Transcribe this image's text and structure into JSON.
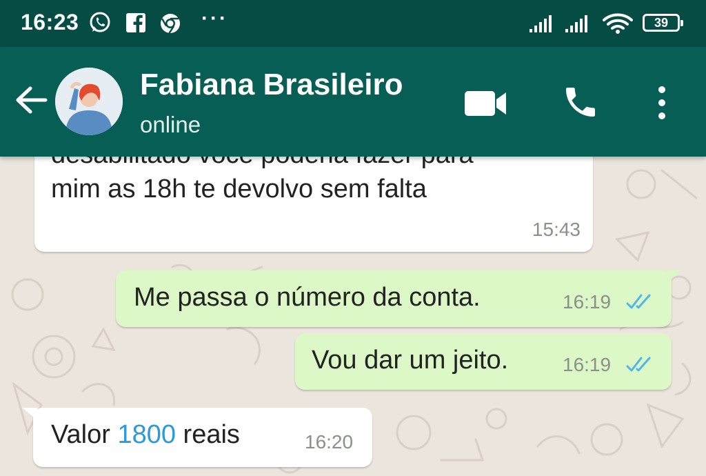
{
  "status_bar": {
    "time": "16:23",
    "battery": "39",
    "more_indicator": "···"
  },
  "header": {
    "contact_name": "Fabiana Brasileiro",
    "contact_status": "online"
  },
  "messages": [
    {
      "direction": "incoming",
      "line1": "desabilitado você poderia fazer para",
      "line2": "mim as 18h te devolvo sem falta",
      "time": "15:43"
    },
    {
      "direction": "outgoing",
      "text": "Me passa o número da conta.",
      "time": "16:19",
      "status": "read"
    },
    {
      "direction": "outgoing",
      "text": "Vou dar um jeito.",
      "time": "16:19",
      "status": "read"
    },
    {
      "direction": "incoming",
      "text_before": "Valor ",
      "amount": "1800",
      "text_after": " reais",
      "time": "16:20"
    }
  ],
  "colors": {
    "status_bar": "#054d44",
    "header": "#075e54",
    "outgoing_bubble": "#dcf8c6",
    "incoming_bubble": "#ffffff",
    "read_ticks": "#4fb6ec",
    "link": "#2b9ad6"
  },
  "icons": [
    "whatsapp-icon",
    "facebook-icon",
    "chrome-icon",
    "signal-icon",
    "wifi-icon",
    "battery-icon",
    "back-arrow-icon",
    "video-call-icon",
    "phone-icon",
    "more-vert-icon",
    "double-check-icon"
  ]
}
